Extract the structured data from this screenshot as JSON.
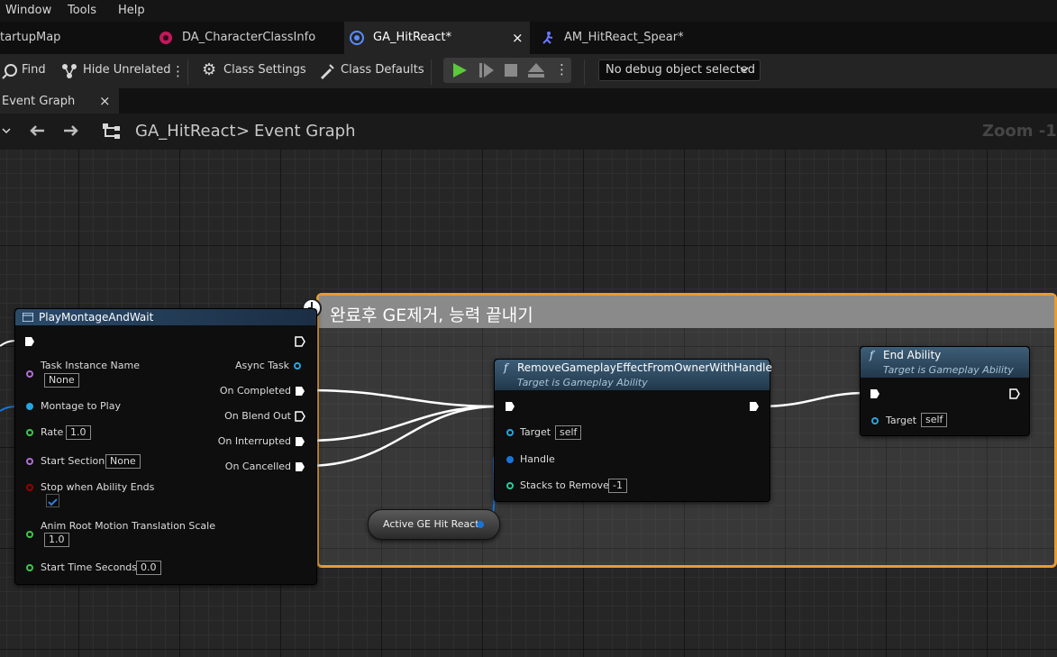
{
  "menu": {
    "window": "Window",
    "tools": "Tools",
    "help": "Help"
  },
  "tabs": [
    {
      "label": "tartupMap"
    },
    {
      "label": "DA_CharacterClassInfo"
    },
    {
      "label": "GA_HitReact*",
      "close": "×"
    },
    {
      "label": "AM_HitReact_Spear*"
    }
  ],
  "toolbar": {
    "find": "Find",
    "hide_unrelated": "Hide Unrelated",
    "class_settings": "Class Settings",
    "class_defaults": "Class Defaults",
    "debug_select": "No debug object selected"
  },
  "graph_tab": {
    "label": "Event Graph",
    "close": "×"
  },
  "breadcrumb": {
    "root": "GA_HitReact",
    "separator": ">",
    "current": "Event Graph",
    "zoom": "Zoom -1"
  },
  "comment": {
    "title": "완료후 GE제거, 능력 끝내기"
  },
  "play_montage": {
    "title": "PlayMontageAndWait",
    "task_instance_name": "Task Instance Name",
    "task_instance_value": "None",
    "montage_to_play": "Montage to Play",
    "rate": "Rate",
    "rate_value": "1.0",
    "start_section": "Start Section",
    "start_section_value": "None",
    "stop_when": "Stop when Ability Ends",
    "anim_root": "Anim Root Motion Translation Scale",
    "anim_root_value": "1.0",
    "start_time": "Start Time Seconds",
    "start_time_value": "0.0",
    "async_task": "Async Task",
    "on_completed": "On Completed",
    "on_blend_out": "On Blend Out",
    "on_interrupted": "On Interrupted",
    "on_cancelled": "On Cancelled"
  },
  "remove_ge": {
    "title": "RemoveGameplayEffectFromOwnerWithHandle",
    "subtitle": "Target is Gameplay Ability",
    "target": "Target",
    "target_value": "self",
    "handle": "Handle",
    "stacks": "Stacks to Remove",
    "stacks_value": "-1"
  },
  "end_ability": {
    "title": "End Ability",
    "subtitle": "Target is Gameplay Ability",
    "target": "Target",
    "target_value": "self"
  },
  "variable": {
    "label": "Active GE Hit React"
  },
  "colors": {
    "comment_border": "#e39d33",
    "task_header": "#2a4a6a",
    "func_header": "#3d5e78",
    "struct_pin": "#1a74d6",
    "float_pin": "#3cc94a",
    "obj_pin": "#27a5e0",
    "name_pin": "#b06fd6",
    "bool_pin": "#9a0000",
    "int_pin": "#1fcfa0"
  }
}
